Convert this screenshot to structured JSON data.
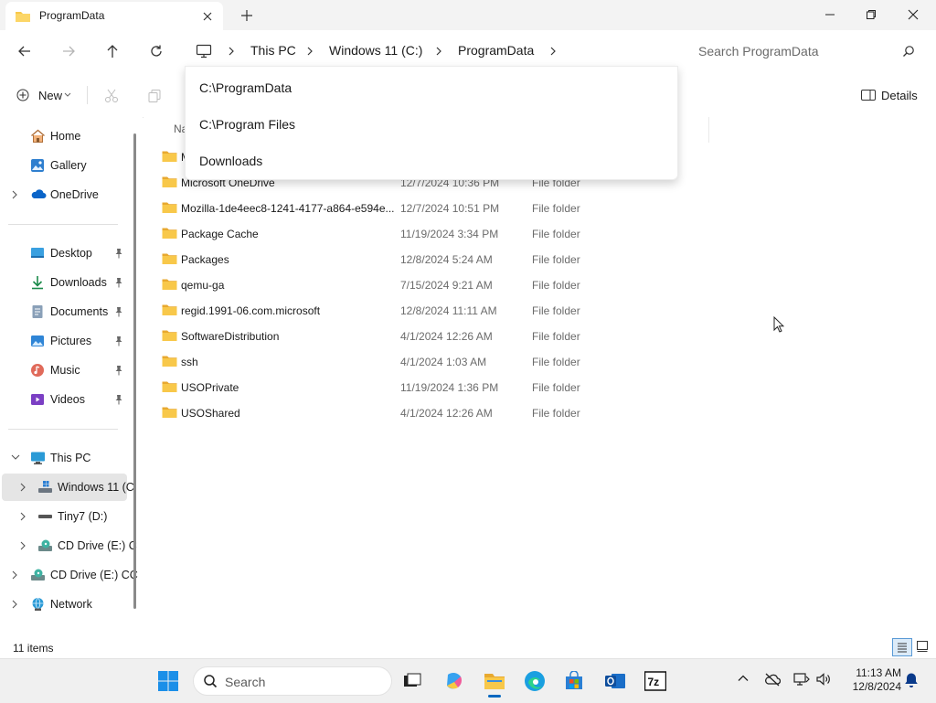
{
  "window": {
    "tab_title": "ProgramData"
  },
  "breadcrumb": [
    "This PC",
    "Windows 11 (C:)",
    "ProgramData"
  ],
  "search": {
    "placeholder": "Search ProgramData"
  },
  "commandbar": {
    "new_label": "New",
    "details_label": "Details"
  },
  "dropdown": {
    "items": [
      "C:\\ProgramData",
      "C:\\Program Files",
      "Downloads"
    ]
  },
  "sidebar": {
    "quick": [
      {
        "label": "Home",
        "icon": "home-icon"
      },
      {
        "label": "Gallery",
        "icon": "gallery-icon"
      },
      {
        "label": "OneDrive",
        "icon": "cloud-icon"
      }
    ],
    "pinned": [
      {
        "label": "Desktop",
        "icon": "desktop-icon"
      },
      {
        "label": "Downloads",
        "icon": "download-icon"
      },
      {
        "label": "Documents",
        "icon": "documents-icon"
      },
      {
        "label": "Pictures",
        "icon": "pictures-icon"
      },
      {
        "label": "Music",
        "icon": "music-icon"
      },
      {
        "label": "Videos",
        "icon": "videos-icon"
      }
    ],
    "thispc": [
      {
        "label": "This PC",
        "icon": "computer-icon"
      },
      {
        "label": "Windows 11 (C",
        "icon": "drive-icon"
      },
      {
        "label": "Tiny7 (D:)",
        "icon": "drive-icon"
      },
      {
        "label": "CD Drive (E:) C",
        "icon": "cd-drive-icon"
      },
      {
        "label": "CD Drive (E:) CC",
        "icon": "cd-drive-icon"
      },
      {
        "label": "Network",
        "icon": "network-icon"
      }
    ]
  },
  "columns": {
    "name": "Na"
  },
  "files": [
    {
      "name": "M",
      "date": "",
      "type": ""
    },
    {
      "name": "Microsoft OneDrive",
      "date": "12/7/2024 10:36 PM",
      "type": "File folder"
    },
    {
      "name": "Mozilla-1de4eec8-1241-4177-a864-e594e...",
      "date": "12/7/2024 10:51 PM",
      "type": "File folder"
    },
    {
      "name": "Package Cache",
      "date": "11/19/2024 3:34 PM",
      "type": "File folder"
    },
    {
      "name": "Packages",
      "date": "12/8/2024 5:24 AM",
      "type": "File folder"
    },
    {
      "name": "qemu-ga",
      "date": "7/15/2024 9:21 AM",
      "type": "File folder"
    },
    {
      "name": "regid.1991-06.com.microsoft",
      "date": "12/8/2024 11:11 AM",
      "type": "File folder"
    },
    {
      "name": "SoftwareDistribution",
      "date": "4/1/2024 12:26 AM",
      "type": "File folder"
    },
    {
      "name": "ssh",
      "date": "4/1/2024 1:03 AM",
      "type": "File folder"
    },
    {
      "name": "USOPrivate",
      "date": "11/19/2024 1:36 PM",
      "type": "File folder"
    },
    {
      "name": "USOShared",
      "date": "4/1/2024 12:26 AM",
      "type": "File folder"
    }
  ],
  "status": {
    "item_count": "11 items"
  },
  "taskbar": {
    "search_placeholder": "Search",
    "time": "11:13 AM",
    "date": "12/8/2024"
  },
  "colors": {
    "folder": "#f8c84a",
    "accent": "#0067c0",
    "selection": "#e5e5e5"
  }
}
